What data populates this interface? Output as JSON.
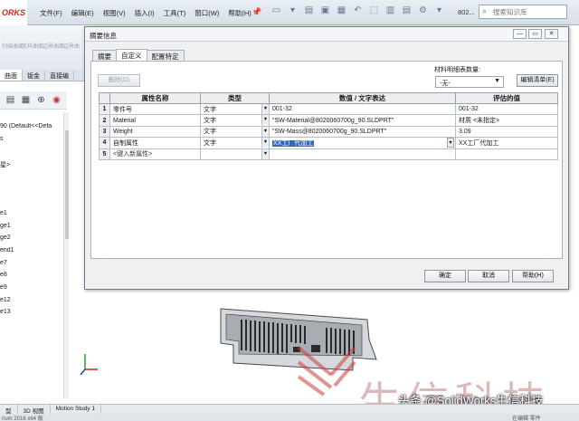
{
  "app": {
    "logo": "ORKS",
    "menu": [
      "文件(F)",
      "编辑(E)",
      "视图(V)",
      "插入(I)",
      "工具(T)",
      "窗口(W)",
      "帮助(H)"
    ],
    "doc_num": "802...",
    "search_placeholder": "搜索知识库",
    "commands": [
      "扫描曲面",
      "放样曲面",
      "边界曲面",
      "边界曲"
    ],
    "fm_tabs": [
      "曲面",
      "钣金",
      "直接编"
    ],
    "tree_items": [
      "90  (Default<<Defa",
      "s",
      "",
      "星>",
      "",
      "",
      "",
      "e1",
      "ge1",
      "ge2",
      "end1",
      "e7",
      "e8",
      "e9",
      "e12",
      "e13"
    ],
    "bottom_tabs": [
      "型",
      "3D 视图",
      "Motion Study 1"
    ],
    "status_left": "rium 2016 x64 版",
    "status_right": "在编辑 零件",
    "watermark": "生信科技",
    "caption": "头条 @SolidWorks生信科技"
  },
  "dialog": {
    "title": "摘要信息",
    "tabs": [
      "摘要",
      "自定义",
      "配置特定"
    ],
    "active_tab": 1,
    "delete_button": "删除(D)",
    "bom_label": "材料明细表数量:",
    "bom_value": "-无-",
    "edit_list_button": "编辑清单(E)",
    "columns": [
      "",
      "属性名称",
      "类型",
      "数值 / 文字表达",
      "评估的值"
    ],
    "rows": [
      {
        "num": "1",
        "name": "零件号",
        "type": "文字",
        "value": "001-32",
        "evaluated": "001-32"
      },
      {
        "num": "2",
        "name": "Material",
        "type": "文字",
        "value": "\"SW-Material@8020060700g_90.SLDPRT\"",
        "evaluated": "材质 <未指定>"
      },
      {
        "num": "3",
        "name": "Weight",
        "type": "文字",
        "value": "\"SW-Mass@8020060700g_90.SLDPRT\"",
        "evaluated": "3.09"
      },
      {
        "num": "4",
        "name": "自制属性",
        "type": "文字",
        "value": "XX工厂代加工",
        "evaluated": "XX工厂代加工"
      },
      {
        "num": "5",
        "name": "<键入新属性>",
        "type": "",
        "value": "",
        "evaluated": ""
      }
    ],
    "ok_button": "确定",
    "cancel_button": "取消",
    "help_button": "帮助(H)"
  }
}
